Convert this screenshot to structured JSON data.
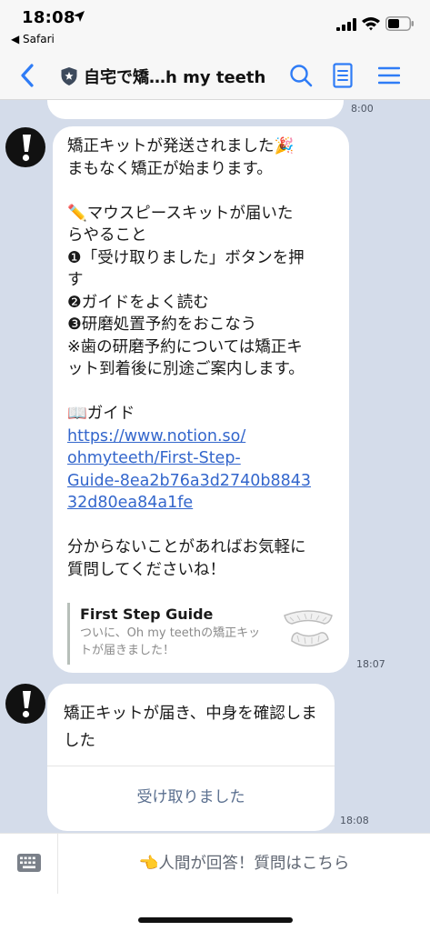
{
  "status_bar": {
    "time": "18:08",
    "back_app": "◀ Safari"
  },
  "nav": {
    "title": "自宅で矯…h my teeth"
  },
  "chat": {
    "prev_time": "8:00",
    "message1": {
      "lines": [
        "矯正キットが発送されました🎉",
        "まもなく矯正が始まります。",
        "",
        "✏️マウスピースキットが届いた",
        "らやること",
        "❶「受け取りました」ボタンを押",
        "す",
        "❷ガイドをよく読む",
        "❸研磨処置予約をおこなう",
        "※歯の研磨予約については矯正キ",
        "ット到着後に別途ご案内します。",
        "",
        "📖ガイド"
      ],
      "link_lines": [
        "https://www.notion.so/",
        "ohmyteeth/First-Step-",
        "Guide-8ea2b76a3d2740b8843",
        "32d80ea84a1fe"
      ],
      "after_lines": [
        "分からないことがあればお気軽に",
        "質問してくださいね！"
      ],
      "preview_title": "First Step Guide",
      "preview_desc": "ついに、Oh my teethの矯正キットが届きました！",
      "time": "18:07"
    },
    "message2": {
      "text": "矯正キットが届き、中身を確認しました",
      "button_label": "受け取りました",
      "time": "18:08"
    }
  },
  "bottom_bar": {
    "rich_menu_label": "👈人間が回答！質問はこちら"
  },
  "colors": {
    "chat_background": "#d4dcea",
    "link": "#3366cc",
    "ios_blue": "#2f7cf6"
  }
}
